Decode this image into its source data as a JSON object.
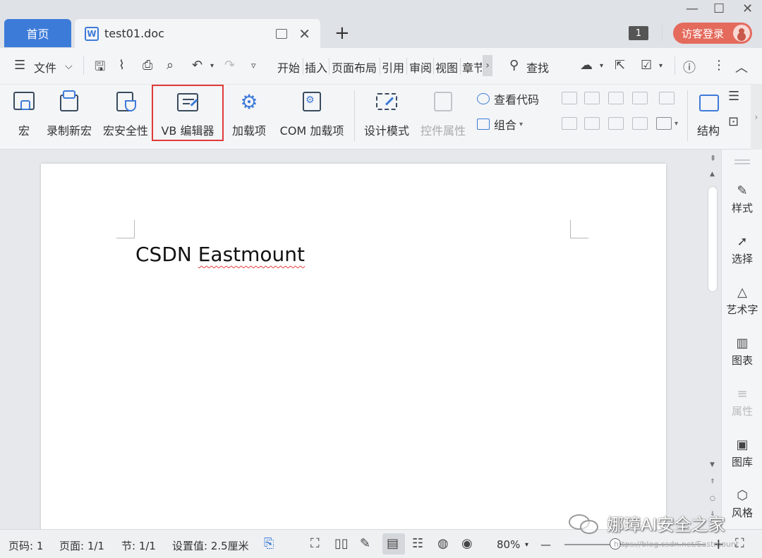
{
  "titlebar": {
    "tab_home": "首页",
    "tab_doc_title": "test01.doc",
    "doc_icon_letter": "W",
    "add_tab": "+",
    "badge": "1",
    "login_label": "访客登录",
    "window_min": "—",
    "window_max": "☐",
    "window_close": "✕"
  },
  "menubar": {
    "file_label": "文件",
    "tabs": [
      "开始",
      "插入",
      "页面布局",
      "引用",
      "审阅",
      "视图",
      "章节"
    ],
    "more": "›",
    "search_label": "查找"
  },
  "ribbon": {
    "buttons": [
      {
        "label": "宏",
        "icon": "macro-icon"
      },
      {
        "label": "录制新宏",
        "icon": "record-macro-icon"
      },
      {
        "label": "宏安全性",
        "icon": "macro-security-icon"
      },
      {
        "label": "VB 编辑器",
        "icon": "vb-editor-icon"
      },
      {
        "label": "加载项",
        "icon": "addin-icon"
      },
      {
        "label": "COM 加载项",
        "icon": "com-addin-icon"
      },
      {
        "label": "设计模式",
        "icon": "design-mode-icon"
      },
      {
        "label": "控件属性",
        "icon": "control-properties-icon"
      }
    ],
    "view_code": "查看代码",
    "group": "组合",
    "structure": "结构"
  },
  "document": {
    "text": "CSDN Eastmount"
  },
  "sidepanel": {
    "items": [
      {
        "label": "样式",
        "icon": "style-icon"
      },
      {
        "label": "选择",
        "icon": "select-icon"
      },
      {
        "label": "艺术字",
        "icon": "wordart-icon"
      },
      {
        "label": "图表",
        "icon": "chart-icon"
      },
      {
        "label": "属性",
        "icon": "properties-icon"
      },
      {
        "label": "图库",
        "icon": "gallery-icon"
      },
      {
        "label": "风格",
        "icon": "theme-icon"
      }
    ]
  },
  "statusbar": {
    "page_num": "页码: 1",
    "page_count": "页面: 1/1",
    "section": "节: 1/1",
    "setting": "设置值: 2.5厘米",
    "zoom": "80%",
    "zoom_minus": "—",
    "zoom_plus": "+"
  },
  "watermark": {
    "text": "娜璋AI安全之家",
    "url": "https://blog.csdn.net/Eastmount"
  },
  "colors": {
    "accent": "#3d7bd8",
    "login": "#e46a5c",
    "highlight": "#e03a3a"
  }
}
